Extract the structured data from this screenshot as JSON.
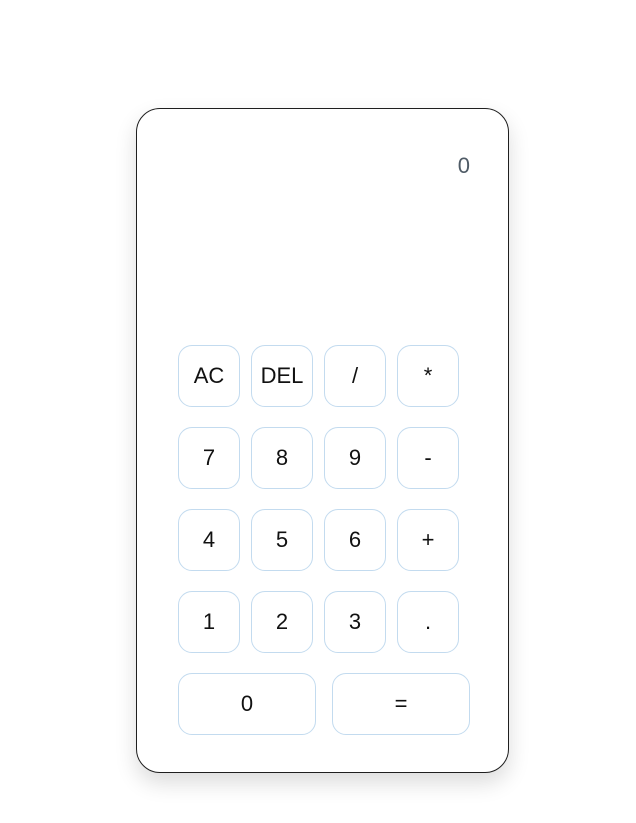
{
  "display": {
    "value": "0"
  },
  "keys": {
    "ac": "AC",
    "del": "DEL",
    "divide": "/",
    "multiply": "*",
    "seven": "7",
    "eight": "8",
    "nine": "9",
    "minus": "-",
    "four": "4",
    "five": "5",
    "six": "6",
    "plus": "+",
    "one": "1",
    "two": "2",
    "three": "3",
    "decimal": ".",
    "zero": "0",
    "equals": "="
  }
}
